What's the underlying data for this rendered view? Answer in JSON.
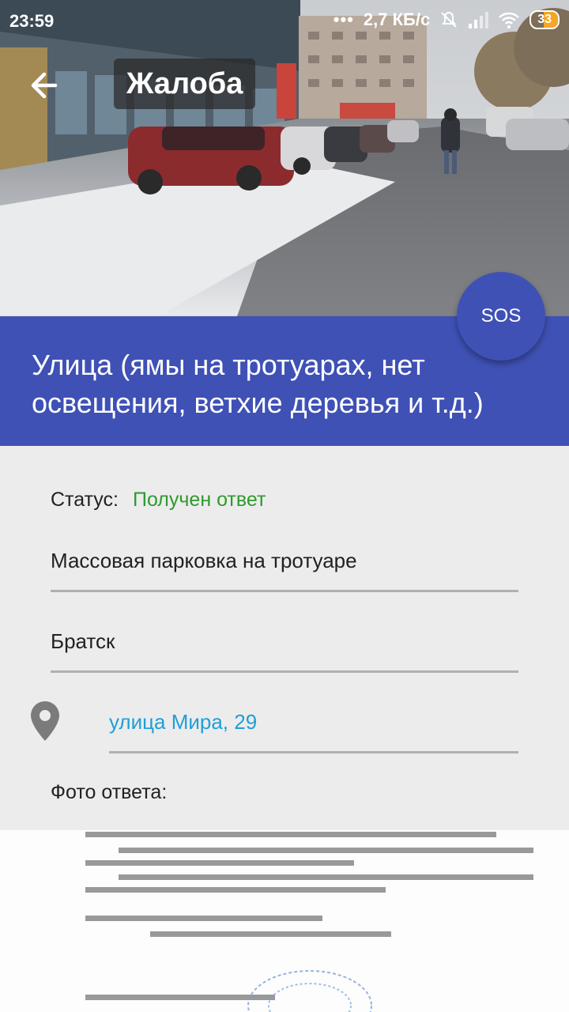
{
  "status_bar": {
    "time": "23:59",
    "network_speed": "2,7 КБ/с",
    "battery": "33",
    "icons": [
      "dots-icon",
      "mute-icon",
      "signal-icon",
      "wifi-icon",
      "battery-icon"
    ]
  },
  "toolbar": {
    "title": "Жалоба",
    "back_icon": "arrow-back-icon"
  },
  "category": {
    "text": "Улица (ямы на тротуарах, нет освещения, ветхие деревья и т.д.)"
  },
  "sos_button": {
    "label": "SOS"
  },
  "form": {
    "status_label": "Статус:",
    "status_value": "Получен ответ",
    "subject": "Массовая парковка на тротуаре",
    "city": "Братск",
    "address": "улица Мира, 29",
    "address_icon": "location-pin-icon",
    "photo_label": "Фото ответа:"
  },
  "colors": {
    "primary": "#3f51b5",
    "status_ok": "#2e9a2e",
    "link": "#1e9fd8",
    "background": "#ececec"
  }
}
